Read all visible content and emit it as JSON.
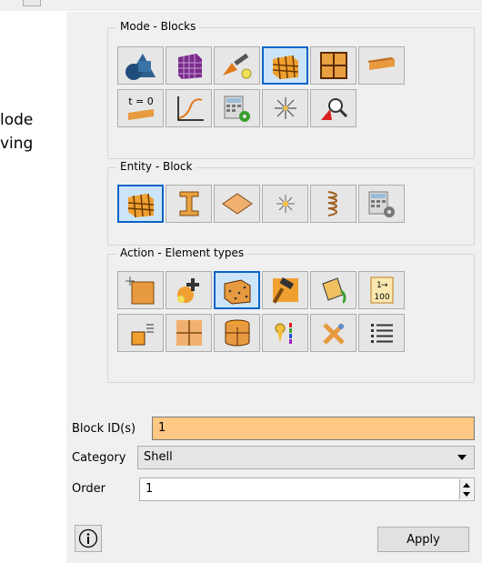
{
  "background_text": {
    "line1": "lode",
    "line2": "ving"
  },
  "groups": {
    "mode": {
      "title": "Mode - Blocks",
      "icons": [
        "geometry-solids-icon",
        "mesh-icon",
        "geometry-tools-icon",
        "blocks-icon",
        "grid-icon",
        "plank-icon",
        "time-zero-icon",
        "graph-icon",
        "calculator-gear-icon",
        "sparkle-icon",
        "zoom-icon"
      ]
    },
    "entity": {
      "title": "Entity - Block",
      "icons": [
        "cube-icon",
        "i-beam-icon",
        "surface-icon",
        "point-icon",
        "spring-icon",
        "calculator-gear-icon"
      ],
      "time_label": "t = 0"
    },
    "action": {
      "title": "Action - Element types",
      "icons": [
        "new-block-icon",
        "add-geometry-icon",
        "element-type-icon",
        "hammer-icon",
        "paint-bucket-icon",
        "renumber-icon",
        "block-list-icon",
        "split-block-icon",
        "cylinder-mesh-icon",
        "legend-icon",
        "delete-icon",
        "list-icon"
      ],
      "renumber_top": "1",
      "renumber_bottom": "100"
    }
  },
  "form": {
    "block_id_label": "Block ID(s)",
    "block_id_value": "1",
    "category_label": "Category",
    "category_value": "Shell",
    "order_label": "Order",
    "order_value": "1"
  },
  "buttons": {
    "apply": "Apply"
  },
  "colors": {
    "highlight_field": "#ffc885",
    "selected_border": "#0a64c8",
    "selected_bg": "#cce4f7"
  }
}
